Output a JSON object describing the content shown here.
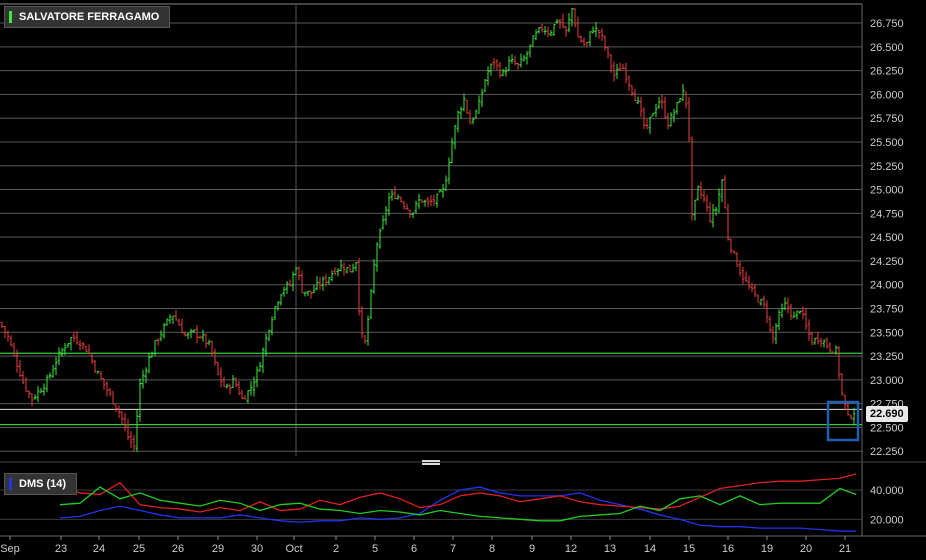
{
  "main_title": "SALVATORE FERRAGAMO",
  "indicator_title": "DMS (14)",
  "last_price": "22.690",
  "colors": {
    "up": "#3ce83c",
    "down": "#e83c3c",
    "dmi_plus": "#22cc22",
    "dmi_minus": "#e02020",
    "adx": "#2233ee",
    "hline": "#33cc33",
    "highlight": "#1e5fb0"
  },
  "chart_data": {
    "type": "ohlc",
    "price_axis": {
      "ylim": [
        22.2,
        26.95
      ],
      "ticks": [
        "22.250",
        "22.500",
        "22.750",
        "23.000",
        "23.250",
        "23.500",
        "23.750",
        "24.000",
        "24.250",
        "24.500",
        "24.750",
        "25.000",
        "25.250",
        "25.500",
        "25.750",
        "26.000",
        "26.250",
        "26.500",
        "26.750"
      ]
    },
    "x_labels": [
      "Sep",
      "23",
      "24",
      "25",
      "26",
      "29",
      "30",
      "Oct",
      "2",
      "5",
      "6",
      "7",
      "8",
      "9",
      "12",
      "13",
      "14",
      "15",
      "16",
      "19",
      "20",
      "21"
    ],
    "horizontal_levels": [
      23.28,
      22.53
    ],
    "price_path": [
      [
        0,
        23.6
      ],
      [
        8,
        23.45
      ],
      [
        16,
        23.2
      ],
      [
        24,
        22.95
      ],
      [
        32,
        22.8
      ],
      [
        40,
        22.9
      ],
      [
        48,
        23.0
      ],
      [
        56,
        23.2
      ],
      [
        64,
        23.35
      ],
      [
        72,
        23.45
      ],
      [
        80,
        23.4
      ],
      [
        88,
        23.3
      ],
      [
        96,
        23.1
      ],
      [
        104,
        22.95
      ],
      [
        112,
        22.8
      ],
      [
        120,
        22.65
      ],
      [
        128,
        22.4
      ],
      [
        134,
        22.3
      ],
      [
        140,
        22.95
      ],
      [
        148,
        23.2
      ],
      [
        156,
        23.4
      ],
      [
        164,
        23.55
      ],
      [
        172,
        23.7
      ],
      [
        178,
        23.6
      ],
      [
        186,
        23.45
      ],
      [
        194,
        23.5
      ],
      [
        202,
        23.45
      ],
      [
        210,
        23.35
      ],
      [
        218,
        23.05
      ],
      [
        226,
        22.9
      ],
      [
        234,
        23.0
      ],
      [
        242,
        22.8
      ],
      [
        250,
        22.9
      ],
      [
        258,
        23.1
      ],
      [
        264,
        23.35
      ],
      [
        270,
        23.6
      ],
      [
        276,
        23.8
      ],
      [
        282,
        23.95
      ],
      [
        290,
        24.0
      ],
      [
        296,
        24.2
      ],
      [
        302,
        23.95
      ],
      [
        310,
        23.9
      ],
      [
        318,
        24.0
      ],
      [
        326,
        24.05
      ],
      [
        334,
        24.15
      ],
      [
        342,
        24.2
      ],
      [
        350,
        24.15
      ],
      [
        356,
        24.25
      ],
      [
        360,
        23.6
      ],
      [
        364,
        23.3
      ],
      [
        370,
        23.8
      ],
      [
        376,
        24.4
      ],
      [
        382,
        24.6
      ],
      [
        388,
        24.9
      ],
      [
        396,
        24.95
      ],
      [
        404,
        24.85
      ],
      [
        412,
        24.75
      ],
      [
        420,
        24.9
      ],
      [
        428,
        24.85
      ],
      [
        436,
        24.9
      ],
      [
        444,
        25.0
      ],
      [
        452,
        25.5
      ],
      [
        458,
        25.8
      ],
      [
        464,
        25.95
      ],
      [
        470,
        25.7
      ],
      [
        478,
        25.85
      ],
      [
        486,
        26.2
      ],
      [
        494,
        26.35
      ],
      [
        502,
        26.2
      ],
      [
        510,
        26.35
      ],
      [
        518,
        26.3
      ],
      [
        526,
        26.4
      ],
      [
        534,
        26.6
      ],
      [
        542,
        26.7
      ],
      [
        550,
        26.65
      ],
      [
        558,
        26.8
      ],
      [
        566,
        26.65
      ],
      [
        572,
        26.9
      ],
      [
        578,
        26.6
      ],
      [
        586,
        26.5
      ],
      [
        592,
        26.7
      ],
      [
        600,
        26.65
      ],
      [
        608,
        26.4
      ],
      [
        614,
        26.2
      ],
      [
        622,
        26.3
      ],
      [
        630,
        26.1
      ],
      [
        638,
        25.9
      ],
      [
        646,
        25.6
      ],
      [
        652,
        25.8
      ],
      [
        660,
        25.95
      ],
      [
        668,
        25.7
      ],
      [
        676,
        25.85
      ],
      [
        682,
        26.05
      ],
      [
        688,
        25.85
      ],
      [
        692,
        24.7
      ],
      [
        698,
        25.0
      ],
      [
        704,
        24.9
      ],
      [
        710,
        24.7
      ],
      [
        716,
        24.8
      ],
      [
        722,
        25.1
      ],
      [
        728,
        24.5
      ],
      [
        734,
        24.3
      ],
      [
        742,
        24.1
      ],
      [
        750,
        23.95
      ],
      [
        758,
        23.85
      ],
      [
        766,
        23.75
      ],
      [
        772,
        23.4
      ],
      [
        778,
        23.65
      ],
      [
        786,
        23.8
      ],
      [
        794,
        23.65
      ],
      [
        800,
        23.75
      ],
      [
        806,
        23.55
      ],
      [
        812,
        23.4
      ],
      [
        820,
        23.45
      ],
      [
        828,
        23.35
      ],
      [
        836,
        23.3
      ],
      [
        842,
        22.85
      ],
      [
        848,
        22.6
      ],
      [
        856,
        22.69
      ]
    ],
    "dmi_axis": {
      "ylim": [
        10,
        55
      ],
      "ticks": [
        "20.000",
        "40.000"
      ]
    },
    "series": [
      {
        "name": "DMS (14)",
        "path": [
          [
            60,
            21
          ],
          [
            80,
            22
          ],
          [
            100,
            26
          ],
          [
            120,
            29
          ],
          [
            140,
            26
          ],
          [
            160,
            23
          ],
          [
            180,
            21
          ],
          [
            200,
            21
          ],
          [
            220,
            21
          ],
          [
            240,
            23
          ],
          [
            260,
            21
          ],
          [
            280,
            19
          ],
          [
            300,
            18
          ],
          [
            320,
            19
          ],
          [
            340,
            19
          ],
          [
            360,
            21
          ],
          [
            380,
            20
          ],
          [
            400,
            21
          ],
          [
            420,
            24
          ],
          [
            440,
            33
          ],
          [
            460,
            40
          ],
          [
            480,
            42
          ],
          [
            500,
            38
          ],
          [
            520,
            36
          ],
          [
            540,
            36
          ],
          [
            560,
            36
          ],
          [
            580,
            38
          ],
          [
            600,
            33
          ],
          [
            620,
            30
          ],
          [
            640,
            27
          ],
          [
            660,
            23
          ],
          [
            680,
            20
          ],
          [
            700,
            16
          ],
          [
            720,
            15
          ],
          [
            740,
            15
          ],
          [
            760,
            14
          ],
          [
            780,
            14
          ],
          [
            800,
            14
          ],
          [
            820,
            13
          ],
          [
            840,
            12
          ],
          [
            856,
            12
          ]
        ]
      },
      {
        "name": "",
        "path": [
          [
            60,
            42
          ],
          [
            80,
            38
          ],
          [
            100,
            37
          ],
          [
            120,
            45
          ],
          [
            140,
            30
          ],
          [
            160,
            28
          ],
          [
            180,
            27
          ],
          [
            200,
            25
          ],
          [
            220,
            28
          ],
          [
            240,
            26
          ],
          [
            260,
            32
          ],
          [
            280,
            26
          ],
          [
            300,
            27
          ],
          [
            320,
            33
          ],
          [
            340,
            30
          ],
          [
            360,
            35
          ],
          [
            380,
            38
          ],
          [
            400,
            34
          ],
          [
            420,
            28
          ],
          [
            440,
            30
          ],
          [
            460,
            36
          ],
          [
            480,
            38
          ],
          [
            500,
            36
          ],
          [
            520,
            32
          ],
          [
            540,
            34
          ],
          [
            560,
            36
          ],
          [
            580,
            32
          ],
          [
            600,
            30
          ],
          [
            620,
            29
          ],
          [
            640,
            28
          ],
          [
            660,
            27
          ],
          [
            680,
            29
          ],
          [
            700,
            35
          ],
          [
            720,
            41
          ],
          [
            740,
            43
          ],
          [
            760,
            45
          ],
          [
            780,
            46
          ],
          [
            800,
            46
          ],
          [
            820,
            47
          ],
          [
            840,
            48
          ],
          [
            856,
            51
          ]
        ]
      },
      {
        "name": "",
        "path": [
          [
            60,
            30
          ],
          [
            80,
            31
          ],
          [
            100,
            42
          ],
          [
            120,
            34
          ],
          [
            140,
            38
          ],
          [
            160,
            33
          ],
          [
            180,
            31
          ],
          [
            200,
            29
          ],
          [
            220,
            33
          ],
          [
            240,
            31
          ],
          [
            260,
            26
          ],
          [
            280,
            30
          ],
          [
            300,
            31
          ],
          [
            320,
            27
          ],
          [
            340,
            26
          ],
          [
            360,
            24
          ],
          [
            380,
            26
          ],
          [
            400,
            25
          ],
          [
            420,
            23
          ],
          [
            440,
            26
          ],
          [
            460,
            24
          ],
          [
            480,
            22
          ],
          [
            500,
            21
          ],
          [
            520,
            20
          ],
          [
            540,
            19
          ],
          [
            560,
            19
          ],
          [
            580,
            22
          ],
          [
            600,
            23
          ],
          [
            620,
            24
          ],
          [
            640,
            29
          ],
          [
            660,
            26
          ],
          [
            680,
            34
          ],
          [
            700,
            36
          ],
          [
            720,
            30
          ],
          [
            740,
            36
          ],
          [
            760,
            30
          ],
          [
            780,
            31
          ],
          [
            800,
            31
          ],
          [
            820,
            31
          ],
          [
            840,
            41
          ],
          [
            856,
            37
          ]
        ]
      }
    ]
  }
}
